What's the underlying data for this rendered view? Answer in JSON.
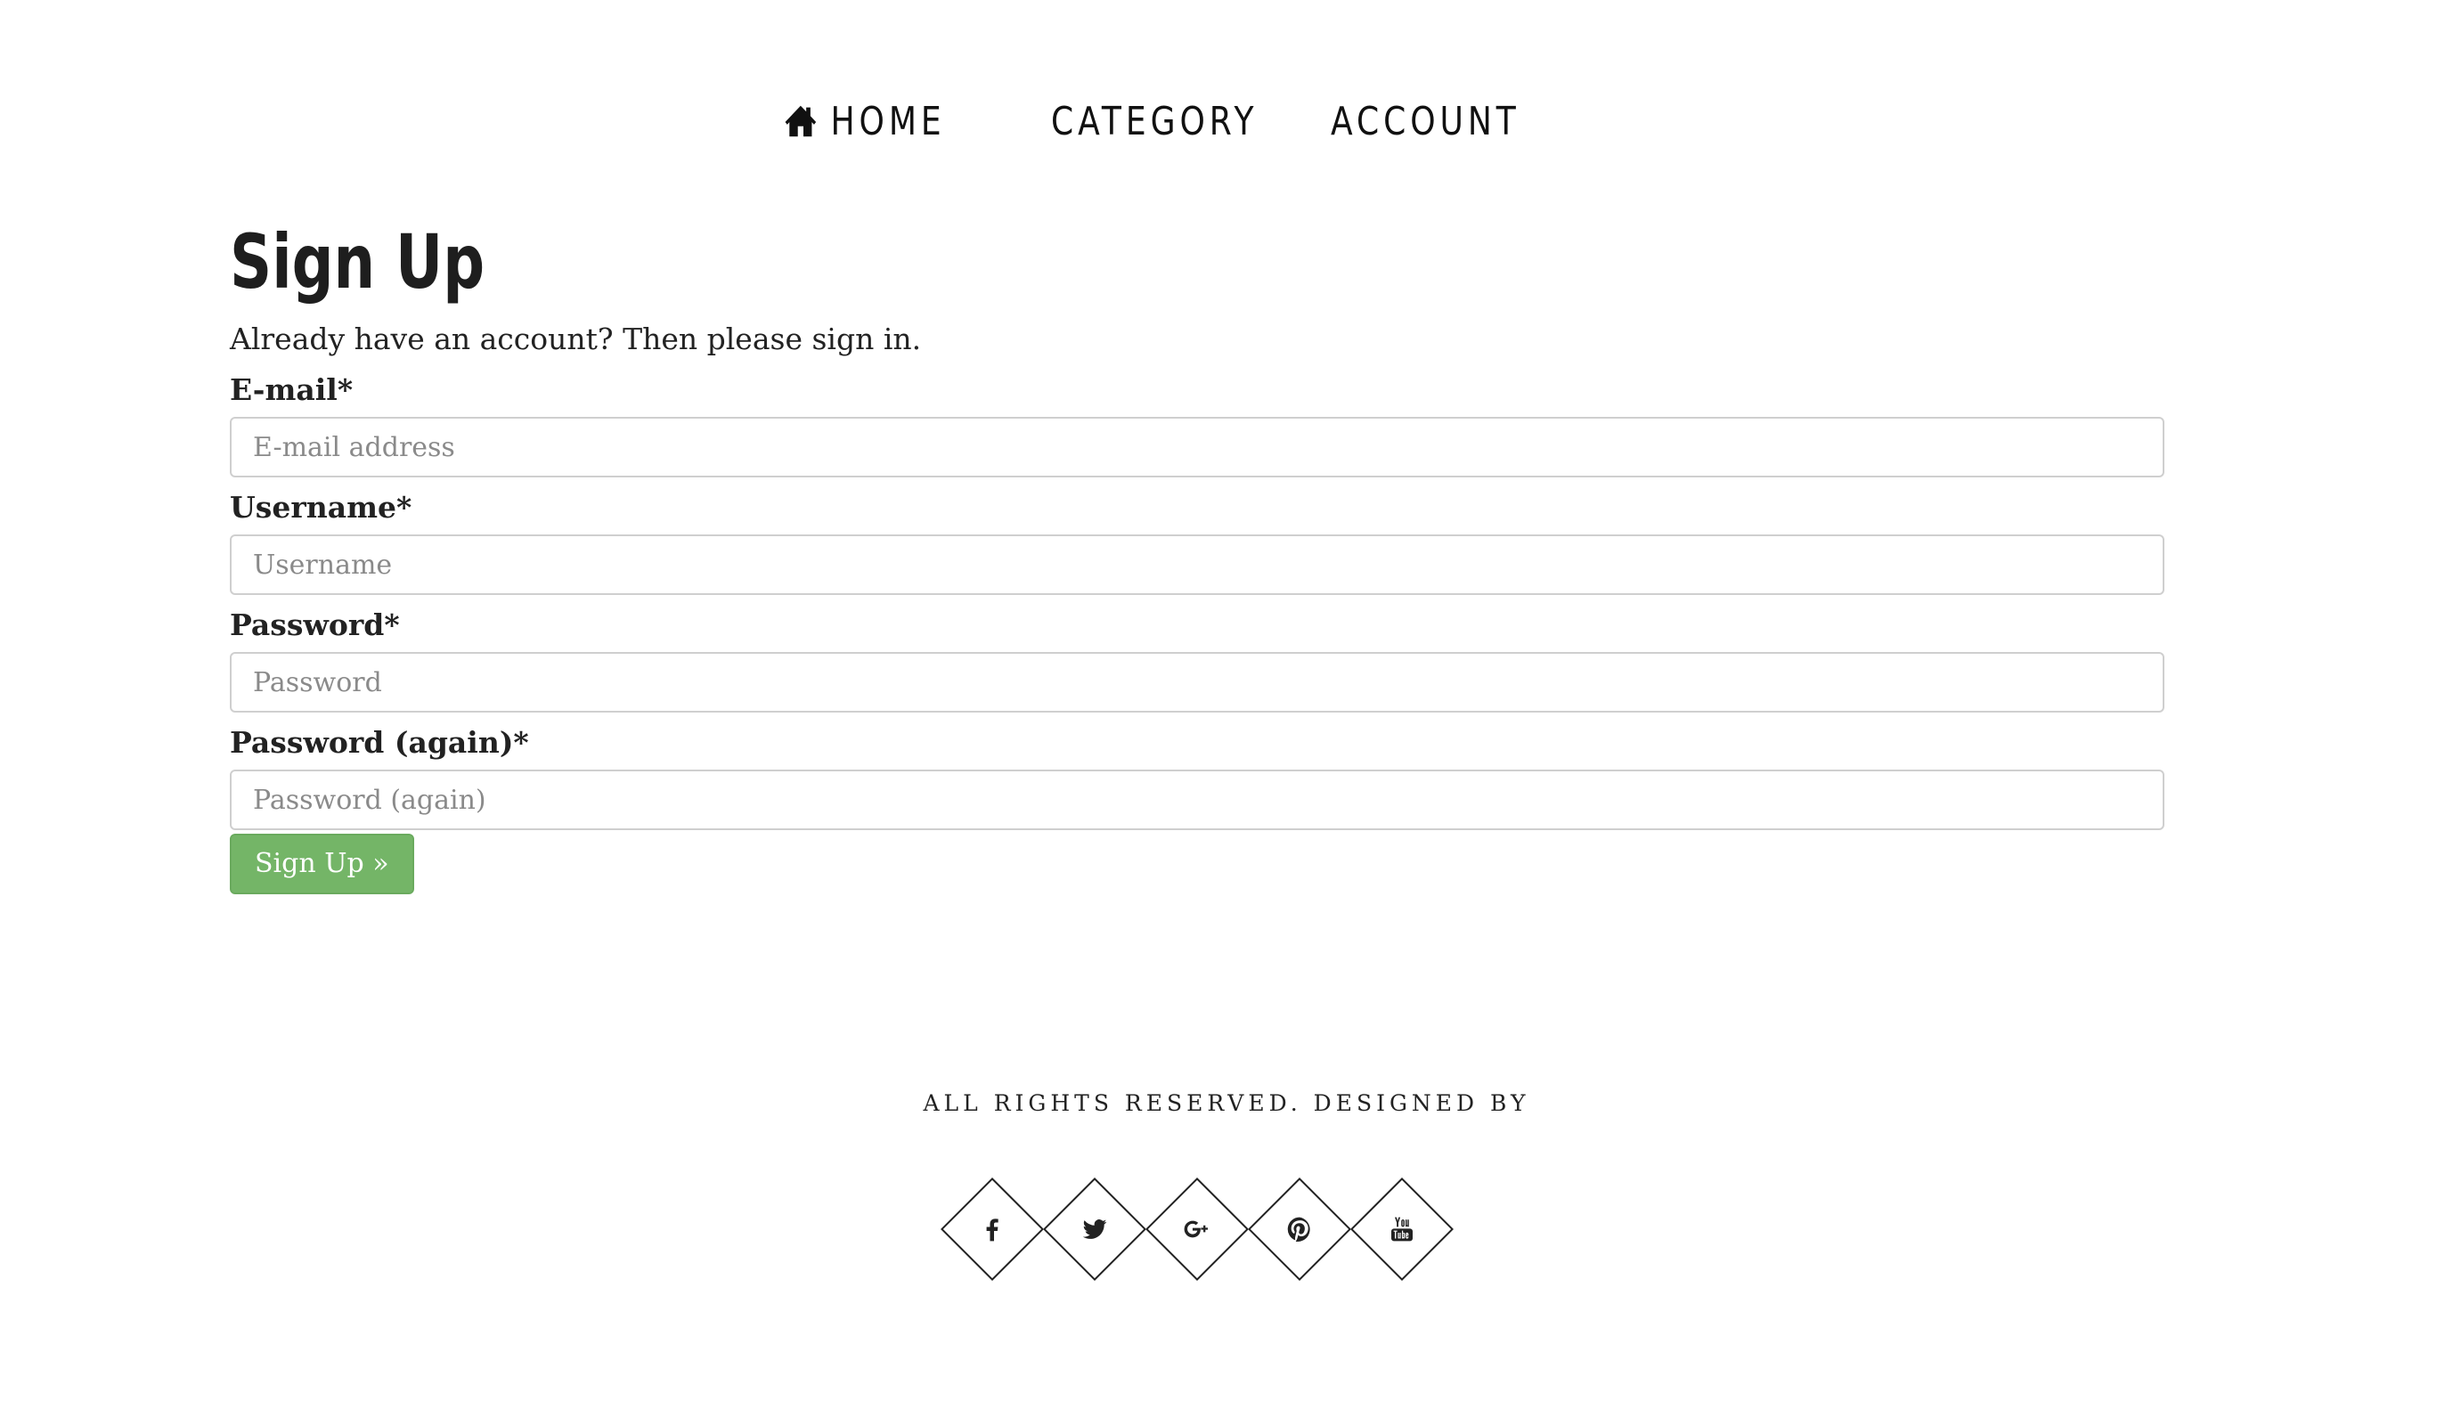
{
  "nav": {
    "items": [
      {
        "label": "HOME",
        "icon": "home-icon"
      },
      {
        "label": "CATEGORY"
      },
      {
        "label": "ACCOUNT"
      }
    ]
  },
  "main": {
    "title": "Sign Up",
    "intro": "Already have an account? Then please sign in.",
    "fields": [
      {
        "label": "E-mail*",
        "placeholder": "E-mail address",
        "value": ""
      },
      {
        "label": "Username*",
        "placeholder": "Username",
        "value": ""
      },
      {
        "label": "Password*",
        "placeholder": "Password",
        "value": ""
      },
      {
        "label": "Password (again)*",
        "placeholder": "Password (again)",
        "value": ""
      }
    ],
    "submit_label": "Sign Up »"
  },
  "footer": {
    "text": "ALL RIGHTS RESERVED. DESIGNED BY",
    "social": [
      {
        "icon": "facebook-icon"
      },
      {
        "icon": "twitter-icon"
      },
      {
        "icon": "google-plus-icon"
      },
      {
        "icon": "pinterest-icon"
      },
      {
        "icon": "youtube-icon"
      }
    ]
  },
  "colors": {
    "accent": "#74b567",
    "text": "#222222",
    "input_border": "#cfcfcf",
    "placeholder": "#8a8a8a"
  }
}
